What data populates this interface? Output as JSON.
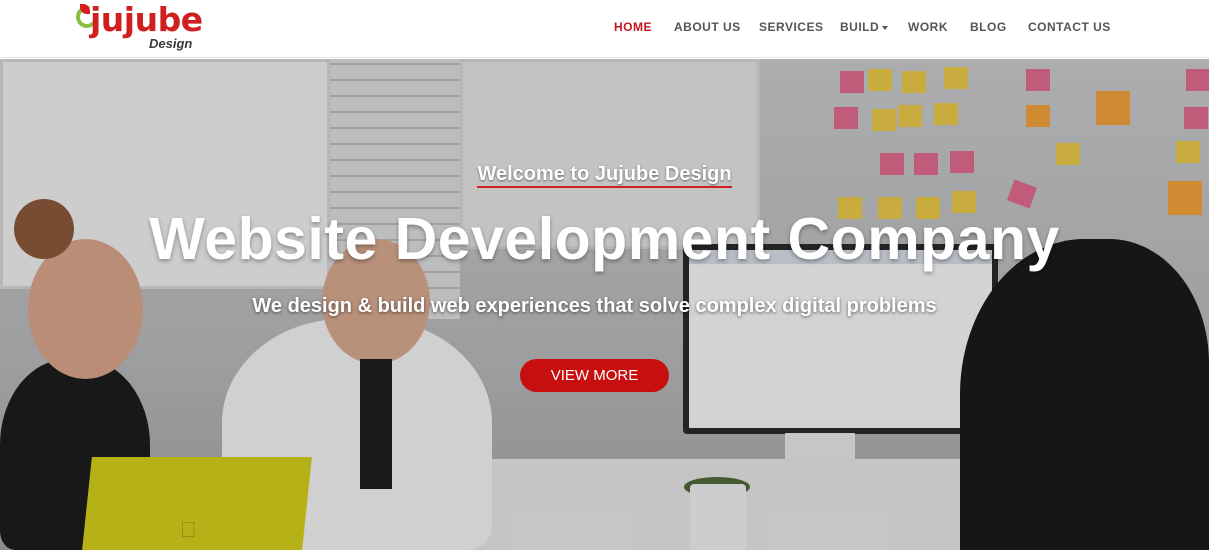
{
  "brand": {
    "wordmark": "jujube",
    "subtitle": "Design",
    "colors": {
      "primary": "#c80f0f",
      "leaf": "#8bbf3f",
      "nav_text": "#555555"
    }
  },
  "nav": {
    "items": [
      {
        "label": "HOME",
        "active": true
      },
      {
        "label": "ABOUT US",
        "active": false
      },
      {
        "label": "SERVICES",
        "active": false
      },
      {
        "label": "BUILD",
        "active": false,
        "dropdown": true,
        "icon": "caret-down-icon"
      },
      {
        "label": "WORK",
        "active": false
      },
      {
        "label": "BLOG",
        "active": false
      },
      {
        "label": "CONTACT US",
        "active": false
      }
    ]
  },
  "hero": {
    "welcome": "Welcome to Jujube Design",
    "headline": "Website Development Company",
    "tagline": "We design & build web experiences that solve complex digital problems",
    "cta_label": "VIEW MORE",
    "background_description_icon": "office-meeting-photo"
  }
}
